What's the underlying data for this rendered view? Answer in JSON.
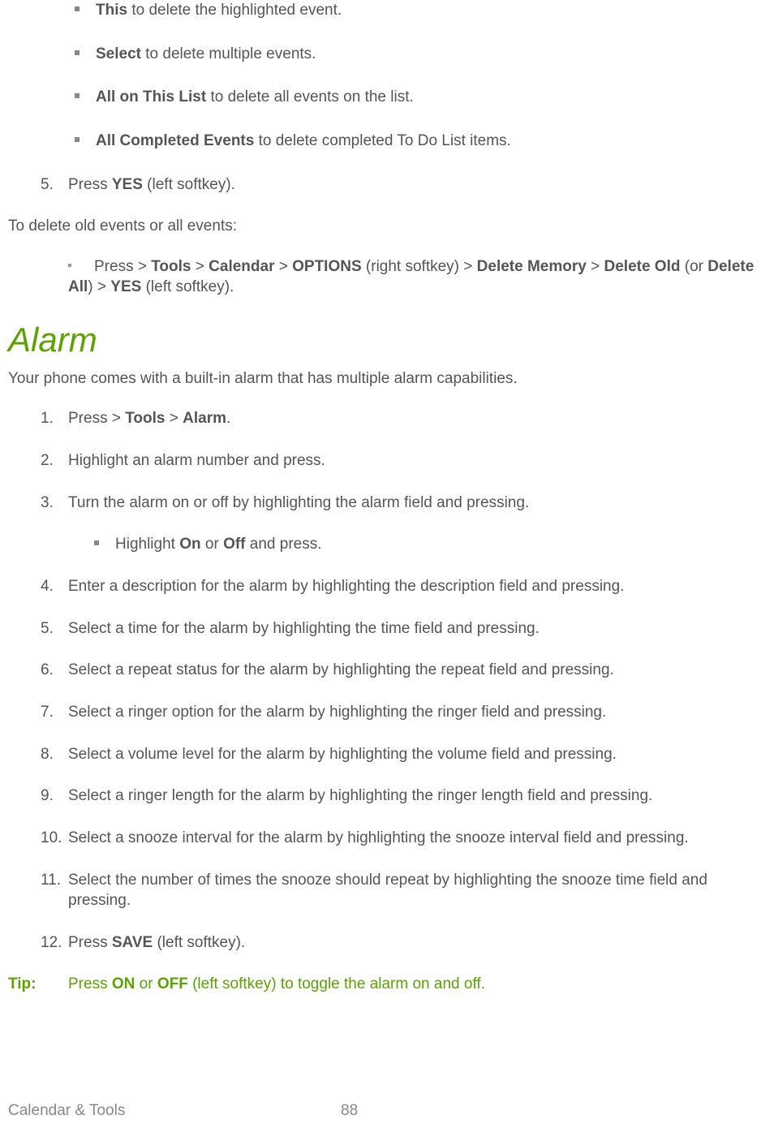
{
  "delete_opts": {
    "this_b": "This",
    "this_t": " to delete the highlighted event.",
    "select_b": "Select",
    "select_t": " to delete multiple events.",
    "allonlist_b": "All on This List",
    "allonlist_t": " to delete all events on the list.",
    "allcompleted_b": "All Completed Events",
    "allcompleted_t": " to delete completed To Do List items."
  },
  "step5": {
    "num": "5.",
    "press": "Press ",
    "yes": "YES",
    "tail": " (left softkey)."
  },
  "delete_old_intro": "To delete old events or all events:",
  "delete_old": {
    "press": "Press ",
    "gt1": " > ",
    "tools": "Tools",
    "gt2": " > ",
    "calendar": "Calendar",
    "gt3": " > ",
    "options": "OPTIONS",
    "rsk": " (right softkey) > ",
    "deletemem": "Delete Memory",
    "gt4": " > ",
    "deleteold": "Delete Old",
    "or_open": " (or ",
    "deleteall": "Delete All",
    "or_close": ") > ",
    "yes": "YES",
    "lsk": " (left softkey)."
  },
  "alarm_heading": "Alarm",
  "alarm_intro": "Your phone comes with a built-in alarm that has multiple alarm capabilities.",
  "alarm_steps": {
    "s1": {
      "num": "1.",
      "press": "Press ",
      "gt1": " > ",
      "tools": "Tools",
      "gt2": " > ",
      "alarm": "Alarm",
      "dot": "."
    },
    "s2": {
      "num": "2.",
      "text": "Highlight an alarm number and press."
    },
    "s3": {
      "num": "3.",
      "text": "Turn the alarm on or off by highlighting the alarm field and pressing."
    },
    "s3sub": {
      "pre": "Highlight ",
      "on": "On",
      "mid": " or ",
      "off": "Off",
      "post": " and press."
    },
    "s4": {
      "num": "4.",
      "text": "Enter a description for the alarm by highlighting the description field and pressing."
    },
    "s5": {
      "num": "5.",
      "text": "Select a time for the alarm by highlighting the time field and pressing."
    },
    "s6": {
      "num": "6.",
      "text": "Select a repeat status for the alarm by highlighting the repeat field and pressing."
    },
    "s7": {
      "num": "7.",
      "text": "Select a ringer option for the alarm by highlighting the ringer field and pressing."
    },
    "s8": {
      "num": "8.",
      "text": "Select a volume level for the alarm by highlighting the volume field and pressing."
    },
    "s9": {
      "num": "9.",
      "text": "Select a ringer length for the alarm by highlighting the ringer length field and pressing."
    },
    "s10": {
      "num": "10.",
      "text": "Select a snooze interval for the alarm by highlighting the snooze interval field and pressing."
    },
    "s11": {
      "num": "11.",
      "text": "Select the number of times the snooze should repeat by highlighting the snooze time field and pressing."
    },
    "s12": {
      "num": "12.",
      "press": "Press ",
      "save": "SAVE",
      "tail": " (left softkey)."
    }
  },
  "tip": {
    "label": "Tip:",
    "pre": "Press ",
    "on": "ON",
    "mid": " or ",
    "off": "OFF",
    "post": " (left softkey) to toggle the alarm on and off."
  },
  "footer": {
    "section": "Calendar & Tools",
    "page": "88"
  }
}
